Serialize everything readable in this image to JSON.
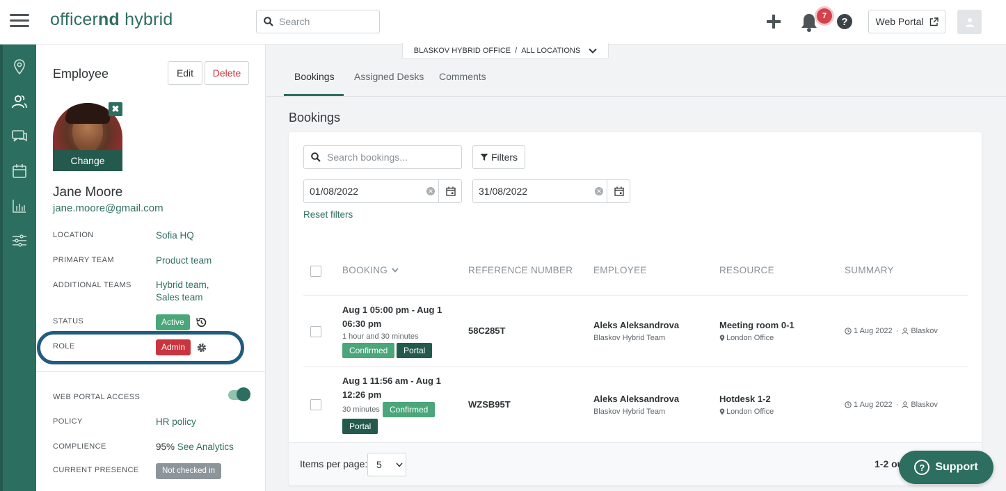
{
  "app": {
    "logo_light": "officer",
    "logo_bold": "nd",
    "logo_rest": " hybrid"
  },
  "topbar": {
    "search_placeholder": "Search",
    "notifications_count": "7",
    "help_glyph": "?",
    "web_portal_label": "Web Portal",
    "icons": [
      "menu-icon",
      "search-icon",
      "plus-icon",
      "bell-icon",
      "help-icon",
      "external-link-icon",
      "user-icon"
    ]
  },
  "rail": {
    "icons": [
      "location-pin-icon",
      "people-icon",
      "chat-icon",
      "calendar-icon",
      "bar-chart-icon",
      "sliders-icon"
    ]
  },
  "profile": {
    "title": "Employee",
    "edit_label": "Edit",
    "delete_label": "Delete",
    "photo_change_label": "Change",
    "photo_remove_glyph": "✖",
    "name": "Jane Moore",
    "email": "jane.moore@gmail.com",
    "fields": {
      "location": {
        "label": "LOCATION",
        "value": "Sofia HQ"
      },
      "primary_team": {
        "label": "PRIMARY TEAM",
        "value": "Product team"
      },
      "additional_teams": {
        "label": "ADDITIONAL TEAMS",
        "value1": "Hybrid team,",
        "value2": "Sales team"
      },
      "status": {
        "label": "STATUS",
        "value": "Active"
      },
      "role": {
        "label": "ROLE",
        "value": "Admin"
      },
      "web_portal_access": {
        "label": "WEB PORTAL ACCESS",
        "enabled": true
      },
      "policy": {
        "label": "POLICY",
        "value": "HR policy"
      },
      "compliance": {
        "label": "COMPLIENCE",
        "value": "95%",
        "link": "See Analytics"
      },
      "current_presence": {
        "label": "CURRENT PRESENCE",
        "value": "Not checked in"
      }
    }
  },
  "location_selector": {
    "office": "BLASKOV HYBRID OFFICE",
    "separator": "/",
    "scope": "ALL LOCATIONS"
  },
  "tabs": [
    {
      "label": "Bookings",
      "active": true
    },
    {
      "label": "Assigned Desks",
      "active": false
    },
    {
      "label": "Comments",
      "active": false
    }
  ],
  "bookings": {
    "title": "Bookings",
    "search_placeholder": "Search bookings...",
    "filters_label": "Filters",
    "date_from": "01/08/2022",
    "date_to": "31/08/2022",
    "reset_filters": "Reset filters",
    "columns": [
      "BOOKING",
      "REFERENCE NUMBER",
      "EMPLOYEE",
      "RESOURCE",
      "SUMMARY"
    ],
    "rows": [
      {
        "time_line1": "Aug 1 05:00 pm - Aug 1",
        "time_line2": "06:30 pm",
        "duration": "1 hour and 30 minutes",
        "status": "Confirmed",
        "source": "Portal",
        "reference": "58C285T",
        "employee": "Aleks Aleksandrova",
        "team": "Blaskov Hybrid Team",
        "resource": "Meeting room 0-1",
        "resource_location": "London Office",
        "summary_date": "1 Aug 2022",
        "summary_sep": "·",
        "summary_user": "Blaskov"
      },
      {
        "time_line1": "Aug 1 11:56 am - Aug 1",
        "time_line2": "12:26 pm",
        "duration": "30 minutes",
        "status": "Confirmed",
        "source": "Portal",
        "reference": "WZSB95T",
        "employee": "Aleks Aleksandrova",
        "team": "Blaskov Hybrid Team",
        "resource": "Hotdesk 1-2",
        "resource_location": "London Office",
        "summary_date": "1 Aug 2022",
        "summary_sep": "·",
        "summary_user": "Blaskov"
      }
    ],
    "items_per_page_label": "Items per page:",
    "items_per_page": "5",
    "range": "1-2 ou"
  },
  "support": {
    "label": "Support",
    "glyph": "?"
  },
  "colors": {
    "brand": "#2c6e5f",
    "danger": "#c9343f",
    "success": "#4ba67a",
    "highlight": "#215c80"
  }
}
